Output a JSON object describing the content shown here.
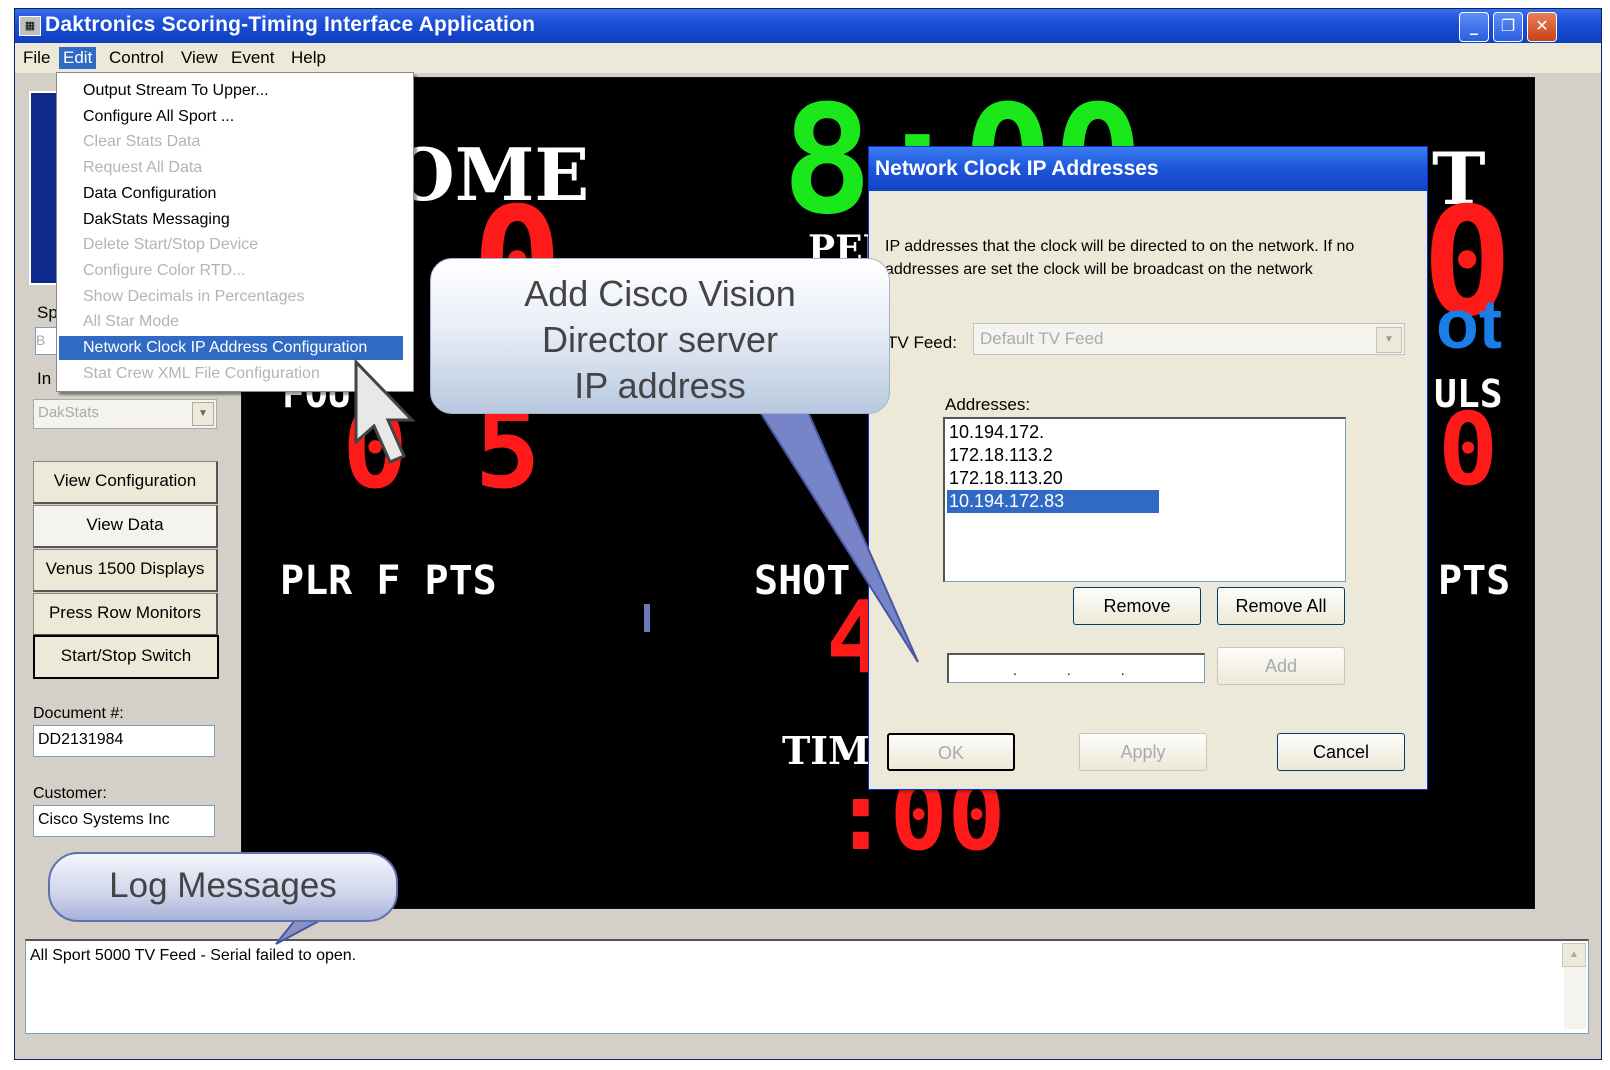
{
  "window": {
    "title": "Daktronics Scoring-Timing Interface Application",
    "icon": "app-icon",
    "buttons": {
      "minimize": "_",
      "maximize": "❐",
      "close": "✕"
    }
  },
  "menubar": {
    "items": [
      "File",
      "Edit",
      "Control",
      "View",
      "Event",
      "Help"
    ],
    "active": "Edit"
  },
  "edit_menu": {
    "items": [
      {
        "label": "Output Stream To Upper...",
        "enabled": true
      },
      {
        "label": "Configure All Sport ...",
        "enabled": true
      },
      {
        "label": "Clear Stats Data",
        "enabled": false
      },
      {
        "label": "Request All Data",
        "enabled": false
      },
      {
        "label": "Data Configuration",
        "enabled": true
      },
      {
        "label": "DakStats Messaging",
        "enabled": true
      },
      {
        "label": "Delete Start/Stop Device",
        "enabled": false
      },
      {
        "label": "Configure Color RTD...",
        "enabled": false
      },
      {
        "label": "Show Decimals in Percentages",
        "enabled": false
      },
      {
        "label": "All Star Mode",
        "enabled": false
      },
      {
        "label": "Network Clock IP Address Configuration",
        "enabled": true,
        "selected": true
      },
      {
        "label": "Stat Crew XML File Configuration",
        "enabled": false
      }
    ]
  },
  "left_panel": {
    "sp_label": "Sp",
    "sp_value": "B",
    "in_label": "In",
    "combo_value": "DakStats",
    "buttons": {
      "view_configuration": "View Configuration",
      "view_data": "View Data",
      "venus_displays": "Venus 1500 Displays",
      "press_row_monitors": "Press Row Monitors",
      "start_stop_switch": "Start/Stop Switch"
    },
    "document_label": "Document #:",
    "document_value": "DD2131984",
    "customer_label": "Customer:",
    "customer_value": "Cisco Systems Inc"
  },
  "scoreboard": {
    "home_label": "OME",
    "clock": "8:00",
    "per_label": "PER",
    "guest_label": "T",
    "home_score": "0",
    "guest_score": "0",
    "fouls_left_label": "FOU",
    "fouls_right_label": "ULS",
    "fouls_left_value": "0 5",
    "fouls_right_value": "0",
    "plr_label": "PLR F PTS",
    "shot_label": "SHOT",
    "right_pts_label": "PTS",
    "shot_value": "4",
    "time_label": "TIME",
    "timeout_value": ":00",
    "brand_fragment": "ot",
    "colors": {
      "red": "#ff1a1a",
      "green": "#1ae81a",
      "blue": "#1a7ee8"
    }
  },
  "callouts": {
    "cisco": [
      "Add Cisco Vision",
      "Director server",
      "IP address"
    ],
    "log": "Log Messages"
  },
  "dialog": {
    "title": "Network Clock IP Addresses",
    "description": "IP addresses that the clock will be directed to on the network. If no addresses are set the clock will be broadcast on the network",
    "tv_feed_label": "TV Feed:",
    "tv_feed_value": "Default TV Feed",
    "addresses_label": "Addresses:",
    "addresses": [
      "10.194.172.",
      "172.18.113.2",
      "172.18.113.20",
      "10.194.172.83"
    ],
    "selected_address": 3,
    "ip_input_value": "...",
    "buttons": {
      "remove": "Remove",
      "remove_all": "Remove All",
      "add": "Add",
      "ok": "OK",
      "apply": "Apply",
      "cancel": "Cancel"
    }
  },
  "log": {
    "messages": [
      "All Sport 5000 TV Feed - Serial failed to open."
    ]
  }
}
